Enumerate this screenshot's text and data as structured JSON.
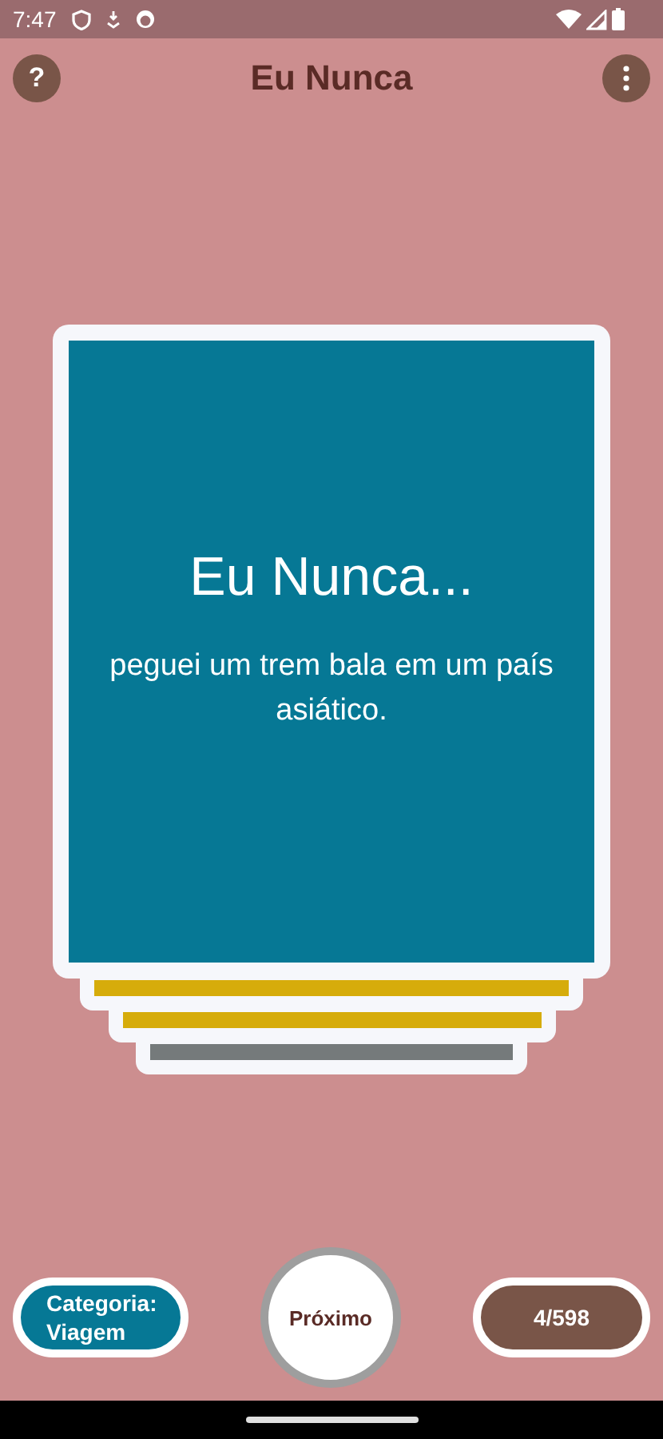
{
  "status_bar": {
    "time": "7:47"
  },
  "app_bar": {
    "title": "Eu Nunca",
    "help": "?"
  },
  "card": {
    "heading": "Eu Nunca...",
    "text": "peguei um trem bala em um país asiático.",
    "color": "#067895"
  },
  "deck": [
    {
      "color": "#d6ac0b"
    },
    {
      "color": "#d6ac0b"
    },
    {
      "color": "#757a7b"
    }
  ],
  "footer": {
    "category": "Categoria: Viagem",
    "next": "Próximo",
    "counter": "4/598"
  }
}
